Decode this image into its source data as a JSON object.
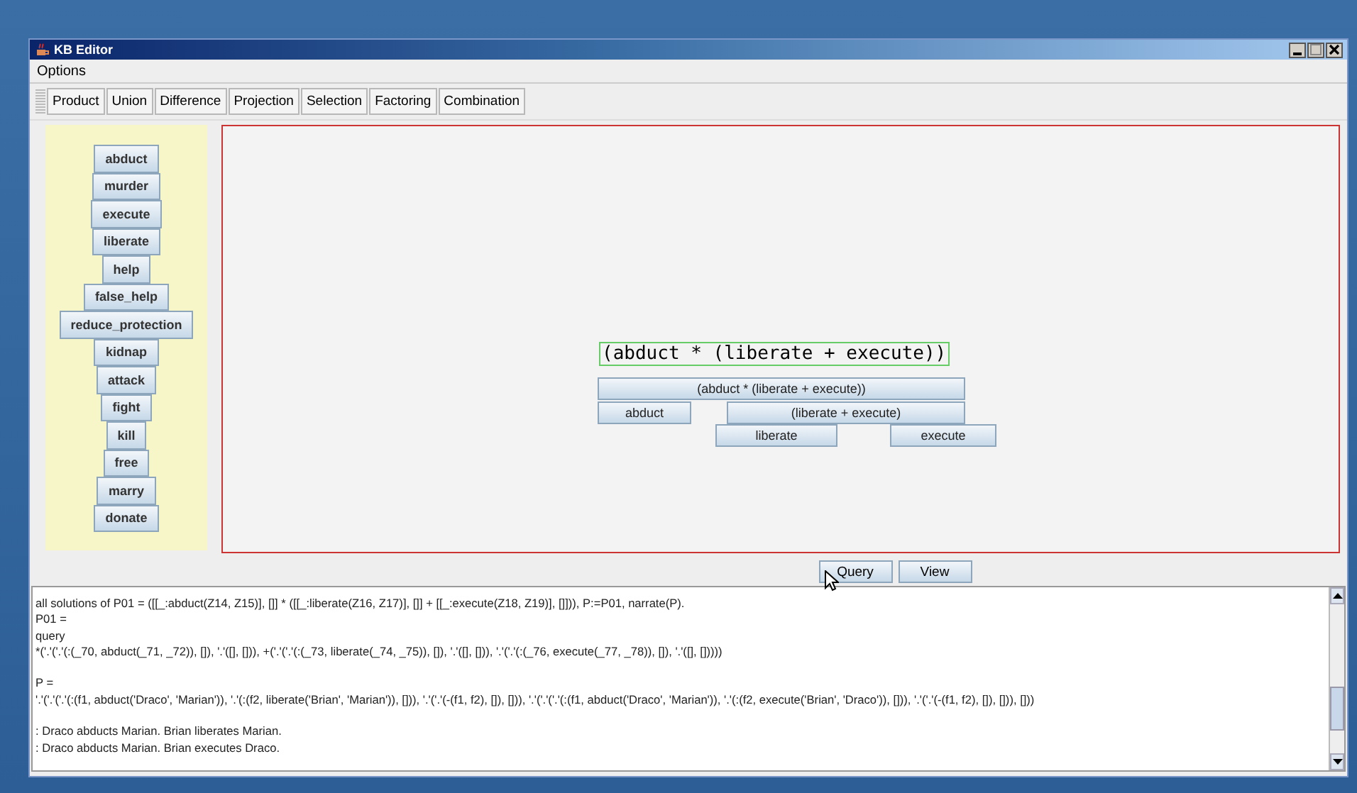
{
  "window": {
    "title": "KB Editor"
  },
  "menu": [
    "Options"
  ],
  "toolbar": [
    "Product",
    "Union",
    "Difference",
    "Projection",
    "Selection",
    "Factoring",
    "Combination"
  ],
  "palette": [
    "abduct",
    "murder",
    "execute",
    "liberate",
    "help",
    "false_help",
    "reduce_protection",
    "kidnap",
    "attack",
    "fight",
    "kill",
    "free",
    "marry",
    "donate"
  ],
  "canvas": {
    "expression": "(abduct * (liberate + execute))",
    "tree": {
      "label": "(abduct * (liberate + execute))",
      "children": [
        {
          "label": "abduct"
        },
        {
          "label": "(liberate + execute)",
          "children": [
            {
              "label": "liberate"
            },
            {
              "label": "execute"
            }
          ]
        }
      ]
    }
  },
  "buttons": [
    "Query",
    "View"
  ],
  "log": [
    [
      "all solutions of P01 = ([[_:abduct(Z14, Z15)], []] * ([[_:liberate(Z16, Z17)], []] + [[_:execute(Z18, Z19)], []])), P:=P01, narrate(P).",
      "P01 =",
      "query",
      "*('.'('.'(:(_70, abduct(_71, _72)), []), '.'([], [])), +('.'('.'(:(_73, liberate(_74, _75)), []), '.'([], [])), '.'('.'(:(_76, execute(_77, _78)), []), '.'([], []))))"
    ],
    [
      "P =",
      "'.'('.'('.'(:(f1, abduct('Draco', 'Marian')), '.'(:(f2, liberate('Brian', 'Marian')), [])), '.'('.'(-(f1, f2), []), [])), '.'('.'('.'(:(f1, abduct('Draco', 'Marian')), '.'(:(f2, execute('Brian', 'Draco')), [])), '.'('.'(-(f1, f2), []), [])), []))"
    ],
    [
      ": Draco abducts Marian. Brian liberates Marian.",
      ": Draco abducts Marian. Brian executes Draco."
    ]
  ]
}
